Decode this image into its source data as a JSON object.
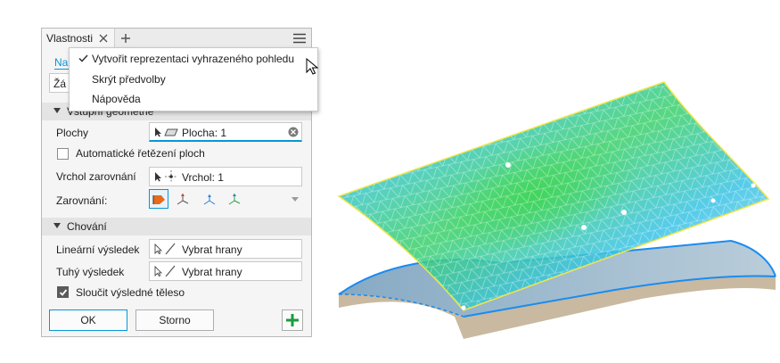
{
  "panel": {
    "title": "Vlastnosti",
    "tab_partial_label": "Na",
    "field_partial_value": "Žá",
    "section_input_geometry": "Vstupní geometrie",
    "plochy_label": "Plochy",
    "plochy_value": "Plocha: 1",
    "auto_chain_label": "Automatické řetězení ploch",
    "vertex_label": "Vrchol zarovnání",
    "vertex_value": "Vrchol: 1",
    "align_label": "Zarovnání:",
    "section_behavior": "Chování",
    "linear_label": "Lineární výsledek",
    "linear_value": "Vybrat hrany",
    "rigid_label": "Tuhý výsledek",
    "rigid_value": "Vybrat hrany",
    "merge_label": "Sloučit výsledné těleso",
    "merge_checked": true,
    "ok_label": "OK",
    "cancel_label": "Storno"
  },
  "menu": {
    "items": [
      {
        "label": "Vytvořit reprezentaci vyhrazeného pohledu",
        "checked": true
      },
      {
        "label": "Skrýt předvolby",
        "checked": false
      },
      {
        "label": "Nápověda",
        "checked": false
      }
    ]
  },
  "colors": {
    "accent_blue": "#0696d7",
    "add_green": "#1a9c3e",
    "mesh_green": "#3ad06a",
    "mesh_cyan": "#39c3e6",
    "mesh_yellow": "#f2c93a",
    "edge_yellow": "#f0e64a"
  },
  "icons": [
    "close-icon",
    "plus-icon",
    "hamburger-menu-icon",
    "checkmark-icon",
    "cursor-icon",
    "face-select-icon",
    "clear-icon",
    "vertex-icon",
    "edge-icon",
    "align-icon",
    "add-icon"
  ]
}
